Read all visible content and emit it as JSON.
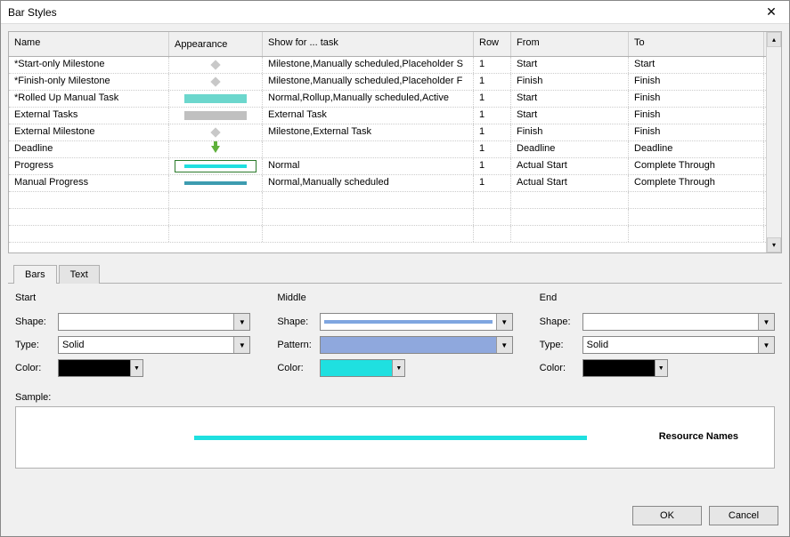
{
  "title": "Bar Styles",
  "columns": {
    "name": "Name",
    "appearance": "Appearance",
    "show": "Show for ... task",
    "row": "Row",
    "from": "From",
    "to": "To"
  },
  "rows": [
    {
      "name": "*Start-only Milestone",
      "app": "diamond",
      "show": "Milestone,Manually scheduled,Placeholder S",
      "row": "1",
      "from": "Start",
      "to": "Start",
      "selected": false
    },
    {
      "name": "*Finish-only Milestone",
      "app": "diamond",
      "show": "Milestone,Manually scheduled,Placeholder F",
      "row": "1",
      "from": "Finish",
      "to": "Finish",
      "selected": false
    },
    {
      "name": "*Rolled Up Manual Task",
      "app": "bar-teal",
      "show": "Normal,Rollup,Manually scheduled,Active",
      "row": "1",
      "from": "Start",
      "to": "Finish",
      "selected": false
    },
    {
      "name": "External Tasks",
      "app": "bar-grey",
      "show": "External Task",
      "row": "1",
      "from": "Start",
      "to": "Finish",
      "selected": false
    },
    {
      "name": "External Milestone",
      "app": "diamond",
      "show": "Milestone,External Task",
      "row": "1",
      "from": "Finish",
      "to": "Finish",
      "selected": false
    },
    {
      "name": "Deadline",
      "app": "arrow-down",
      "show": "",
      "row": "1",
      "from": "Deadline",
      "to": "Deadline",
      "selected": false
    },
    {
      "name": "Progress",
      "app": "line-cyan",
      "show": "Normal",
      "row": "1",
      "from": "Actual Start",
      "to": "Complete Through",
      "selected": true
    },
    {
      "name": "Manual Progress",
      "app": "line-teal",
      "show": "Normal,Manually scheduled",
      "row": "1",
      "from": "Actual Start",
      "to": "Complete Through",
      "selected": false
    },
    {
      "name": "",
      "app": "",
      "show": "",
      "row": "",
      "from": "",
      "to": "",
      "selected": false
    },
    {
      "name": "",
      "app": "",
      "show": "",
      "row": "",
      "from": "",
      "to": "",
      "selected": false
    },
    {
      "name": "",
      "app": "",
      "show": "",
      "row": "",
      "from": "",
      "to": "",
      "selected": false
    }
  ],
  "tabs": {
    "bars": "Bars",
    "text": "Text"
  },
  "section_titles": {
    "start": "Start",
    "middle": "Middle",
    "end": "End"
  },
  "labels": {
    "shape": "Shape:",
    "type": "Type:",
    "pattern": "Pattern:",
    "color": "Color:",
    "sample": "Sample:"
  },
  "start": {
    "shape": "",
    "type": "Solid",
    "color": "#000000"
  },
  "middle": {
    "shape": "thin-blue",
    "pattern": "solid-blue",
    "color": "#1fe0e0"
  },
  "end": {
    "shape": "",
    "type": "Solid",
    "color": "#000000"
  },
  "sample_text": "Resource Names",
  "buttons": {
    "ok": "OK",
    "cancel": "Cancel"
  }
}
